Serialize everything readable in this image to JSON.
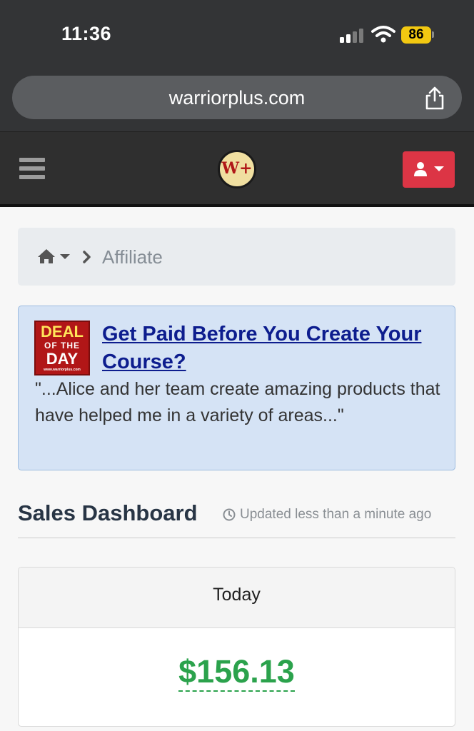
{
  "status_bar": {
    "time": "11:36",
    "battery": "86"
  },
  "browser": {
    "url": "warriorplus.com"
  },
  "navbar": {
    "logo_text": "W+"
  },
  "breadcrumb": {
    "current": "Affiliate"
  },
  "deal": {
    "badge_line1": "DEAL",
    "badge_line2": "OF THE",
    "badge_line3": "DAY",
    "badge_line4": "www.warriorplus.com",
    "title": "Get Paid Before You Create Your Course?",
    "quote": "\"...Alice and her team create amazing products that have helped me in a variety of areas...\""
  },
  "dashboard": {
    "title": "Sales Dashboard",
    "updated": "Updated less than a minute ago",
    "panel_label": "Today",
    "panel_value": "$156.13"
  },
  "colors": {
    "navbar": "#2f2f2f",
    "user_button": "#dc3545",
    "deal_bg": "#d5e3f5",
    "deal_link": "#0d1d8e",
    "money": "#2ba24c"
  },
  "icons": [
    "cellular-signal-icon",
    "wifi-icon",
    "share-icon",
    "hamburger-menu-icon",
    "user-icon",
    "caret-down-icon",
    "home-icon",
    "chevron-right-icon",
    "clock-icon"
  ]
}
